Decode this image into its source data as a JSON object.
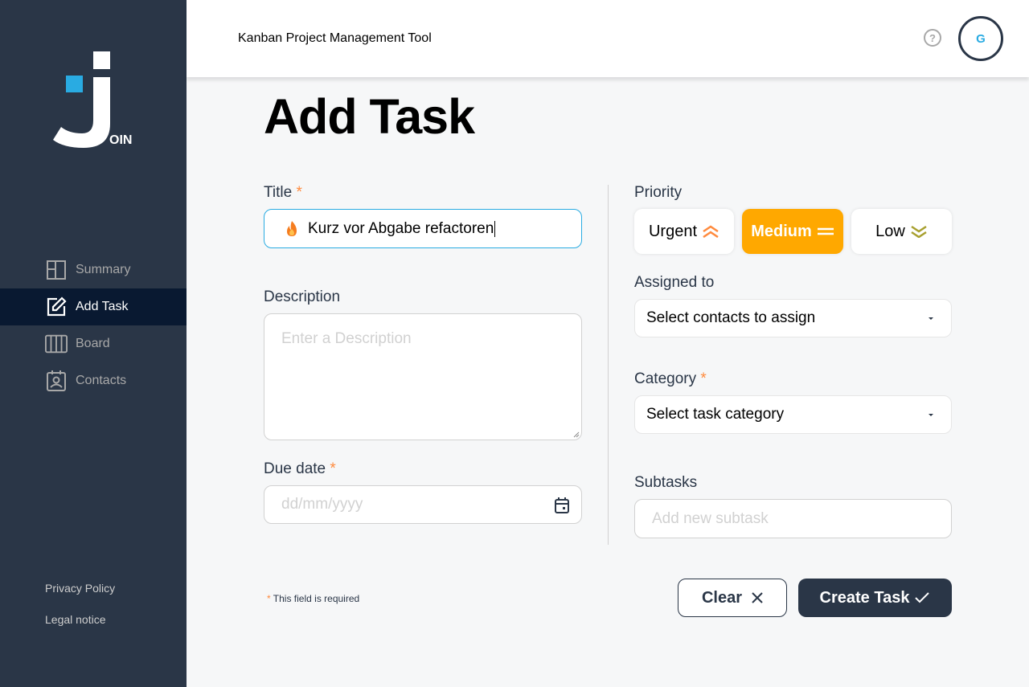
{
  "header": {
    "app_title": "Kanban Project Management Tool",
    "help_icon": "help-icon",
    "help_glyph": "?",
    "avatar_initial": "G"
  },
  "sidebar": {
    "logo_text": "OIN",
    "items": [
      {
        "label": "Summary",
        "icon": "summary-icon",
        "active": false
      },
      {
        "label": "Add Task",
        "icon": "edit-icon",
        "active": true
      },
      {
        "label": "Board",
        "icon": "board-icon",
        "active": false
      },
      {
        "label": "Contacts",
        "icon": "contacts-icon",
        "active": false
      }
    ],
    "footer": {
      "privacy": "Privacy Policy",
      "legal": "Legal notice"
    }
  },
  "main": {
    "page_title": "Add Task",
    "title_label": "Title",
    "title_value": "Kurz vor Abgabe refactoren",
    "title_emoji_icon": "fire-icon",
    "description_label": "Description",
    "description_placeholder": "Enter a Description",
    "due_label": "Due date",
    "due_placeholder": "dd/mm/yyyy",
    "priority_label": "Priority",
    "priority": {
      "urgent": "Urgent",
      "medium": "Medium",
      "low": "Low",
      "selected": "Medium"
    },
    "assigned_label": "Assigned to",
    "assigned_value": "Select contacts to assign",
    "category_label": "Category",
    "category_value": "Select task category",
    "subtasks_label": "Subtasks",
    "subtask_placeholder": "Add new subtask",
    "required_star": "*",
    "required_note": "This field is required",
    "clear_label": "Clear",
    "create_label": "Create Task"
  },
  "colors": {
    "sidebar_bg": "#2a3647",
    "active_nav_bg": "#091931",
    "accent_blue": "#29abe2",
    "urgent": "#ff8a3d",
    "medium": "#ffa800",
    "low": "#a8a02f",
    "required": "#ff8a3d"
  }
}
